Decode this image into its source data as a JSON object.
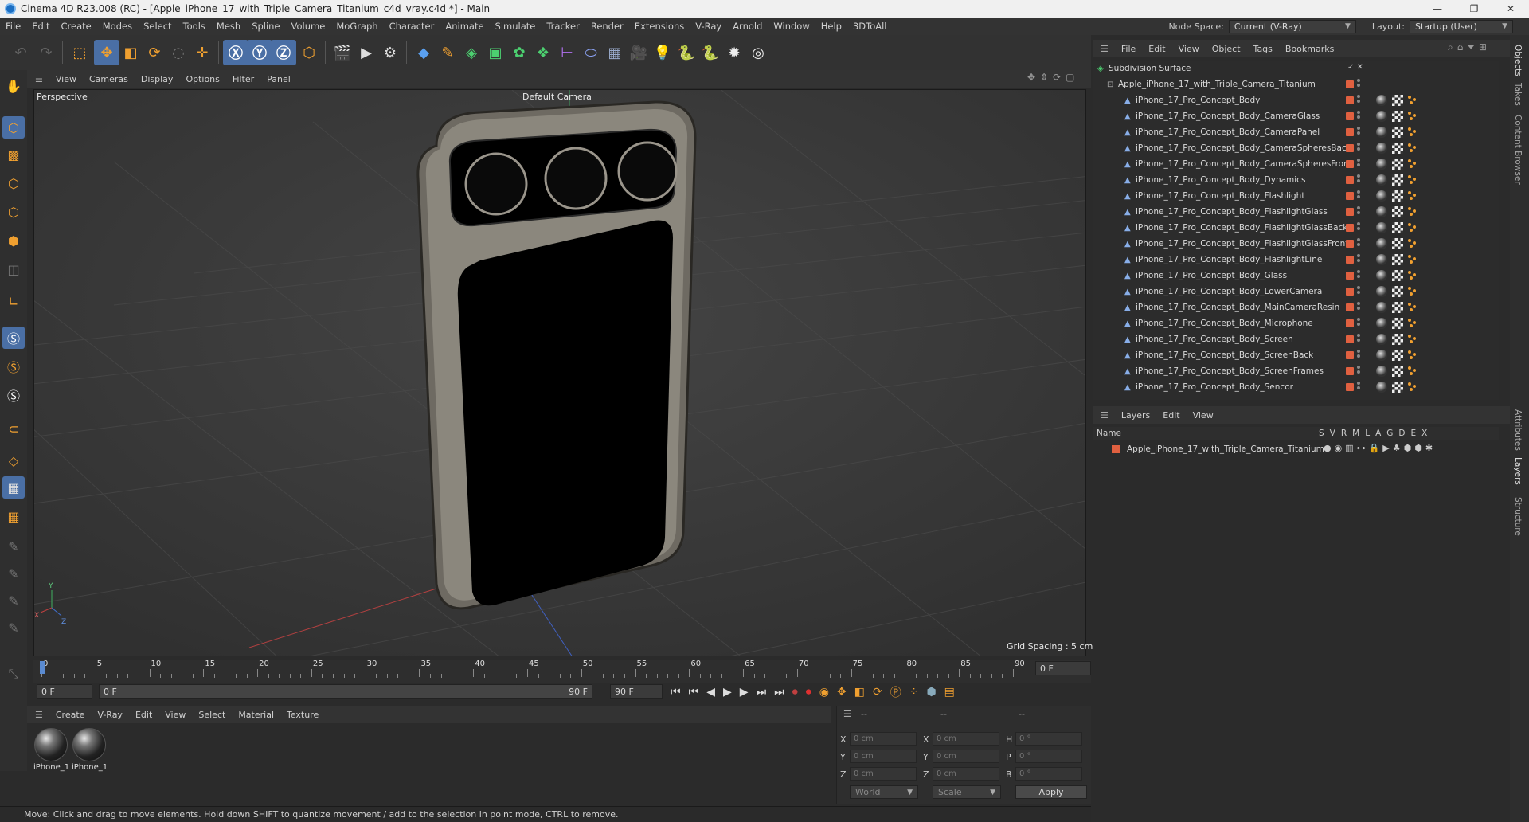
{
  "window": {
    "title": "Cinema 4D R23.008 (RC) - [Apple_iPhone_17_with_Triple_Camera_Titanium_c4d_vray.c4d *] - Main",
    "controls": [
      "—",
      "❐",
      "✕"
    ]
  },
  "menubar": {
    "items": [
      "File",
      "Edit",
      "Create",
      "Modes",
      "Select",
      "Tools",
      "Mesh",
      "Spline",
      "Volume",
      "MoGraph",
      "Character",
      "Animate",
      "Simulate",
      "Tracker",
      "Render",
      "Extensions",
      "V-Ray",
      "Arnold",
      "Window",
      "Help",
      "3DToAll"
    ],
    "node_space_label": "Node Space:",
    "node_space_value": "Current (V-Ray)",
    "layout_label": "Layout:",
    "layout_value": "Startup (User)"
  },
  "viewport": {
    "menu": [
      "View",
      "Cameras",
      "Display",
      "Options",
      "Filter",
      "Panel"
    ],
    "label": "Perspective",
    "camera": "Default Camera",
    "grid_spacing": "Grid Spacing : 5 cm"
  },
  "timeline": {
    "ticks": [
      "0",
      "5",
      "10",
      "15",
      "20",
      "25",
      "30",
      "35",
      "40",
      "45",
      "50",
      "55",
      "60",
      "65",
      "70",
      "75",
      "80",
      "85",
      "90"
    ],
    "current_frame": "0 F",
    "start_field": "0 F",
    "range_start": "0 F",
    "range_end": "90 F",
    "end_field": "90 F"
  },
  "material_manager": {
    "menu": [
      "Create",
      "V-Ray",
      "Edit",
      "View",
      "Select",
      "Material",
      "Texture"
    ],
    "materials": [
      "iPhone_1",
      "iPhone_1"
    ]
  },
  "coordinates": {
    "header": [
      "--",
      "--",
      "--"
    ],
    "rows": [
      {
        "a": "X",
        "av": "0 cm",
        "b": "X",
        "bv": "0 cm",
        "c": "H",
        "cv": "0 °"
      },
      {
        "a": "Y",
        "av": "0 cm",
        "b": "Y",
        "bv": "0 cm",
        "c": "P",
        "cv": "0 °"
      },
      {
        "a": "Z",
        "av": "0 cm",
        "b": "Z",
        "bv": "0 cm",
        "c": "B",
        "cv": "0 °"
      }
    ],
    "mode": "World",
    "scale": "Scale",
    "apply": "Apply"
  },
  "status": "Move: Click and drag to move elements. Hold down SHIFT to quantize movement / add to the selection in point mode, CTRL to remove.",
  "object_manager": {
    "menu": [
      "File",
      "Edit",
      "View",
      "Object",
      "Tags",
      "Bookmarks"
    ],
    "root": "Subdivision Surface",
    "group": "Apple_iPhone_17_with_Triple_Camera_Titanium",
    "objects": [
      "iPhone_17_Pro_Concept_Body",
      "iPhone_17_Pro_Concept_Body_CameraGlass",
      "iPhone_17_Pro_Concept_Body_CameraPanel",
      "iPhone_17_Pro_Concept_Body_CameraSpheresBack",
      "iPhone_17_Pro_Concept_Body_CameraSpheresFront",
      "iPhone_17_Pro_Concept_Body_Dynamics",
      "iPhone_17_Pro_Concept_Body_Flashlight",
      "iPhone_17_Pro_Concept_Body_FlashlightGlass",
      "iPhone_17_Pro_Concept_Body_FlashlightGlassBack",
      "iPhone_17_Pro_Concept_Body_FlashlightGlassFront",
      "iPhone_17_Pro_Concept_Body_FlashlightLine",
      "iPhone_17_Pro_Concept_Body_Glass",
      "iPhone_17_Pro_Concept_Body_LowerCamera",
      "iPhone_17_Pro_Concept_Body_MainCameraResin",
      "iPhone_17_Pro_Concept_Body_Microphone",
      "iPhone_17_Pro_Concept_Body_Screen",
      "iPhone_17_Pro_Concept_Body_ScreenBack",
      "iPhone_17_Pro_Concept_Body_ScreenFrames",
      "iPhone_17_Pro_Concept_Body_Sencor"
    ]
  },
  "layers": {
    "menu": [
      "Layers",
      "Edit",
      "View"
    ],
    "name_header": "Name",
    "columns": [
      "S",
      "V",
      "R",
      "M",
      "L",
      "A",
      "G",
      "D",
      "E",
      "X"
    ],
    "items": [
      "Apple_iPhone_17_with_Triple_Camera_Titanium"
    ]
  },
  "side_tabs": [
    "Objects",
    "Takes",
    "Content Browser",
    "Attributes",
    "Layers",
    "Structure"
  ],
  "colors": {
    "accent": "#4a6fa5",
    "layer": "#e06040"
  }
}
